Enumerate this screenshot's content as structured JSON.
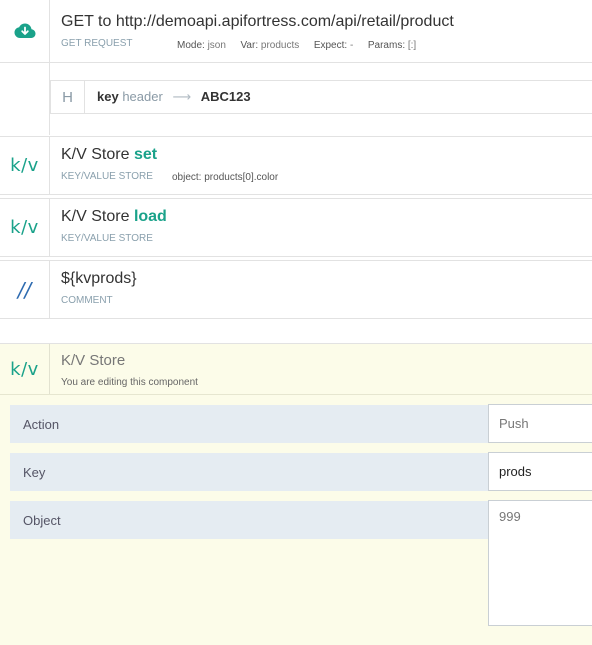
{
  "get_request": {
    "title": "GET to http://demoapi.apifortress.com/api/retail/product",
    "subtitle": "GET REQUEST",
    "mode_label": "Mode:",
    "mode_value": "json",
    "var_label": "Var:",
    "var_value": "products",
    "expect_label": "Expect:",
    "expect_value": "-",
    "params_label": "Params:",
    "params_value": "[:]",
    "icon": "cloud-download-icon"
  },
  "header": {
    "badge": "H",
    "key": "key",
    "key_label": "header",
    "arrow": "⟶",
    "value": "ABC123"
  },
  "kv_set": {
    "glyph": "k/v",
    "title_prefix": "K/V Store",
    "action": "set",
    "subtitle": "KEY/VALUE STORE",
    "object_label": "object:",
    "object_value": "products[0].color"
  },
  "kv_load": {
    "glyph": "k/v",
    "title_prefix": "K/V Store",
    "action": "load",
    "subtitle": "KEY/VALUE STORE"
  },
  "comment": {
    "glyph": "//",
    "title": "${kvprods}",
    "subtitle": "COMMENT"
  },
  "editing": {
    "glyph": "k/v",
    "title": "K/V Store",
    "subtitle": "You are editing this component",
    "fields": {
      "action_label": "Action",
      "action_value": "Push",
      "key_label": "Key",
      "key_value": "prods",
      "object_label": "Object",
      "object_value": "999"
    }
  },
  "colors": {
    "accent": "#1aa28a",
    "comment": "#2e6bb0",
    "edit_bg": "#fcfce9",
    "label_bg": "#e5ecf2"
  }
}
